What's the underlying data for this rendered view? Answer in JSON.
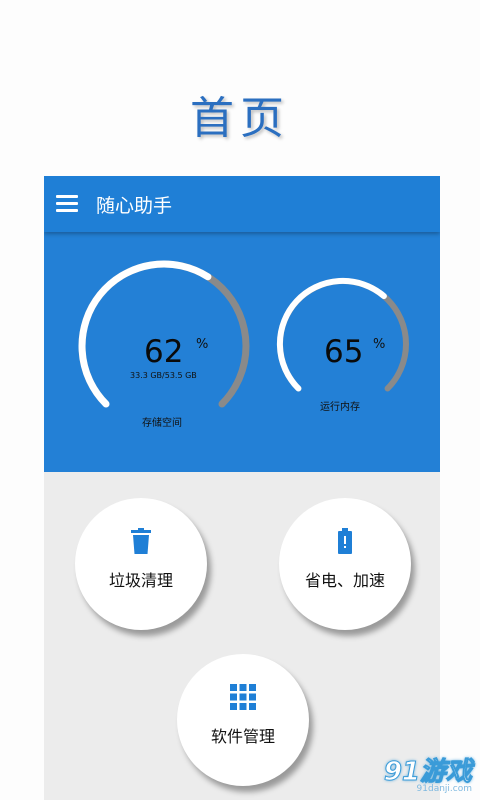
{
  "promo_title": "首页",
  "app_bar": {
    "menu_icon": "hamburger-menu-icon",
    "title": "随心助手"
  },
  "storage_gauge": {
    "percent": "62",
    "percent_value": 62,
    "unit": "%",
    "detail": "33.3 GB/53.5 GB",
    "label": "存储空间"
  },
  "memory_gauge": {
    "percent": "65",
    "percent_value": 65,
    "unit": "%",
    "label": "运行内存"
  },
  "actions": [
    {
      "label": "垃圾清理",
      "icon": "trash-can-icon"
    },
    {
      "label": "省电、加速",
      "icon": "battery-alert-icon"
    },
    {
      "label": "软件管理",
      "icon": "app-grid-icon"
    }
  ],
  "watermark": {
    "logo": "91游戏",
    "url": "91danji.com"
  },
  "colors": {
    "primary_blue": "#1f7fd6",
    "dashboard_blue": "#2380d6",
    "gauge_track": "#8a8a8a",
    "gauge_fill": "#ffffff",
    "content_bg": "#ececec",
    "promo_title": "#2b6fc0"
  }
}
